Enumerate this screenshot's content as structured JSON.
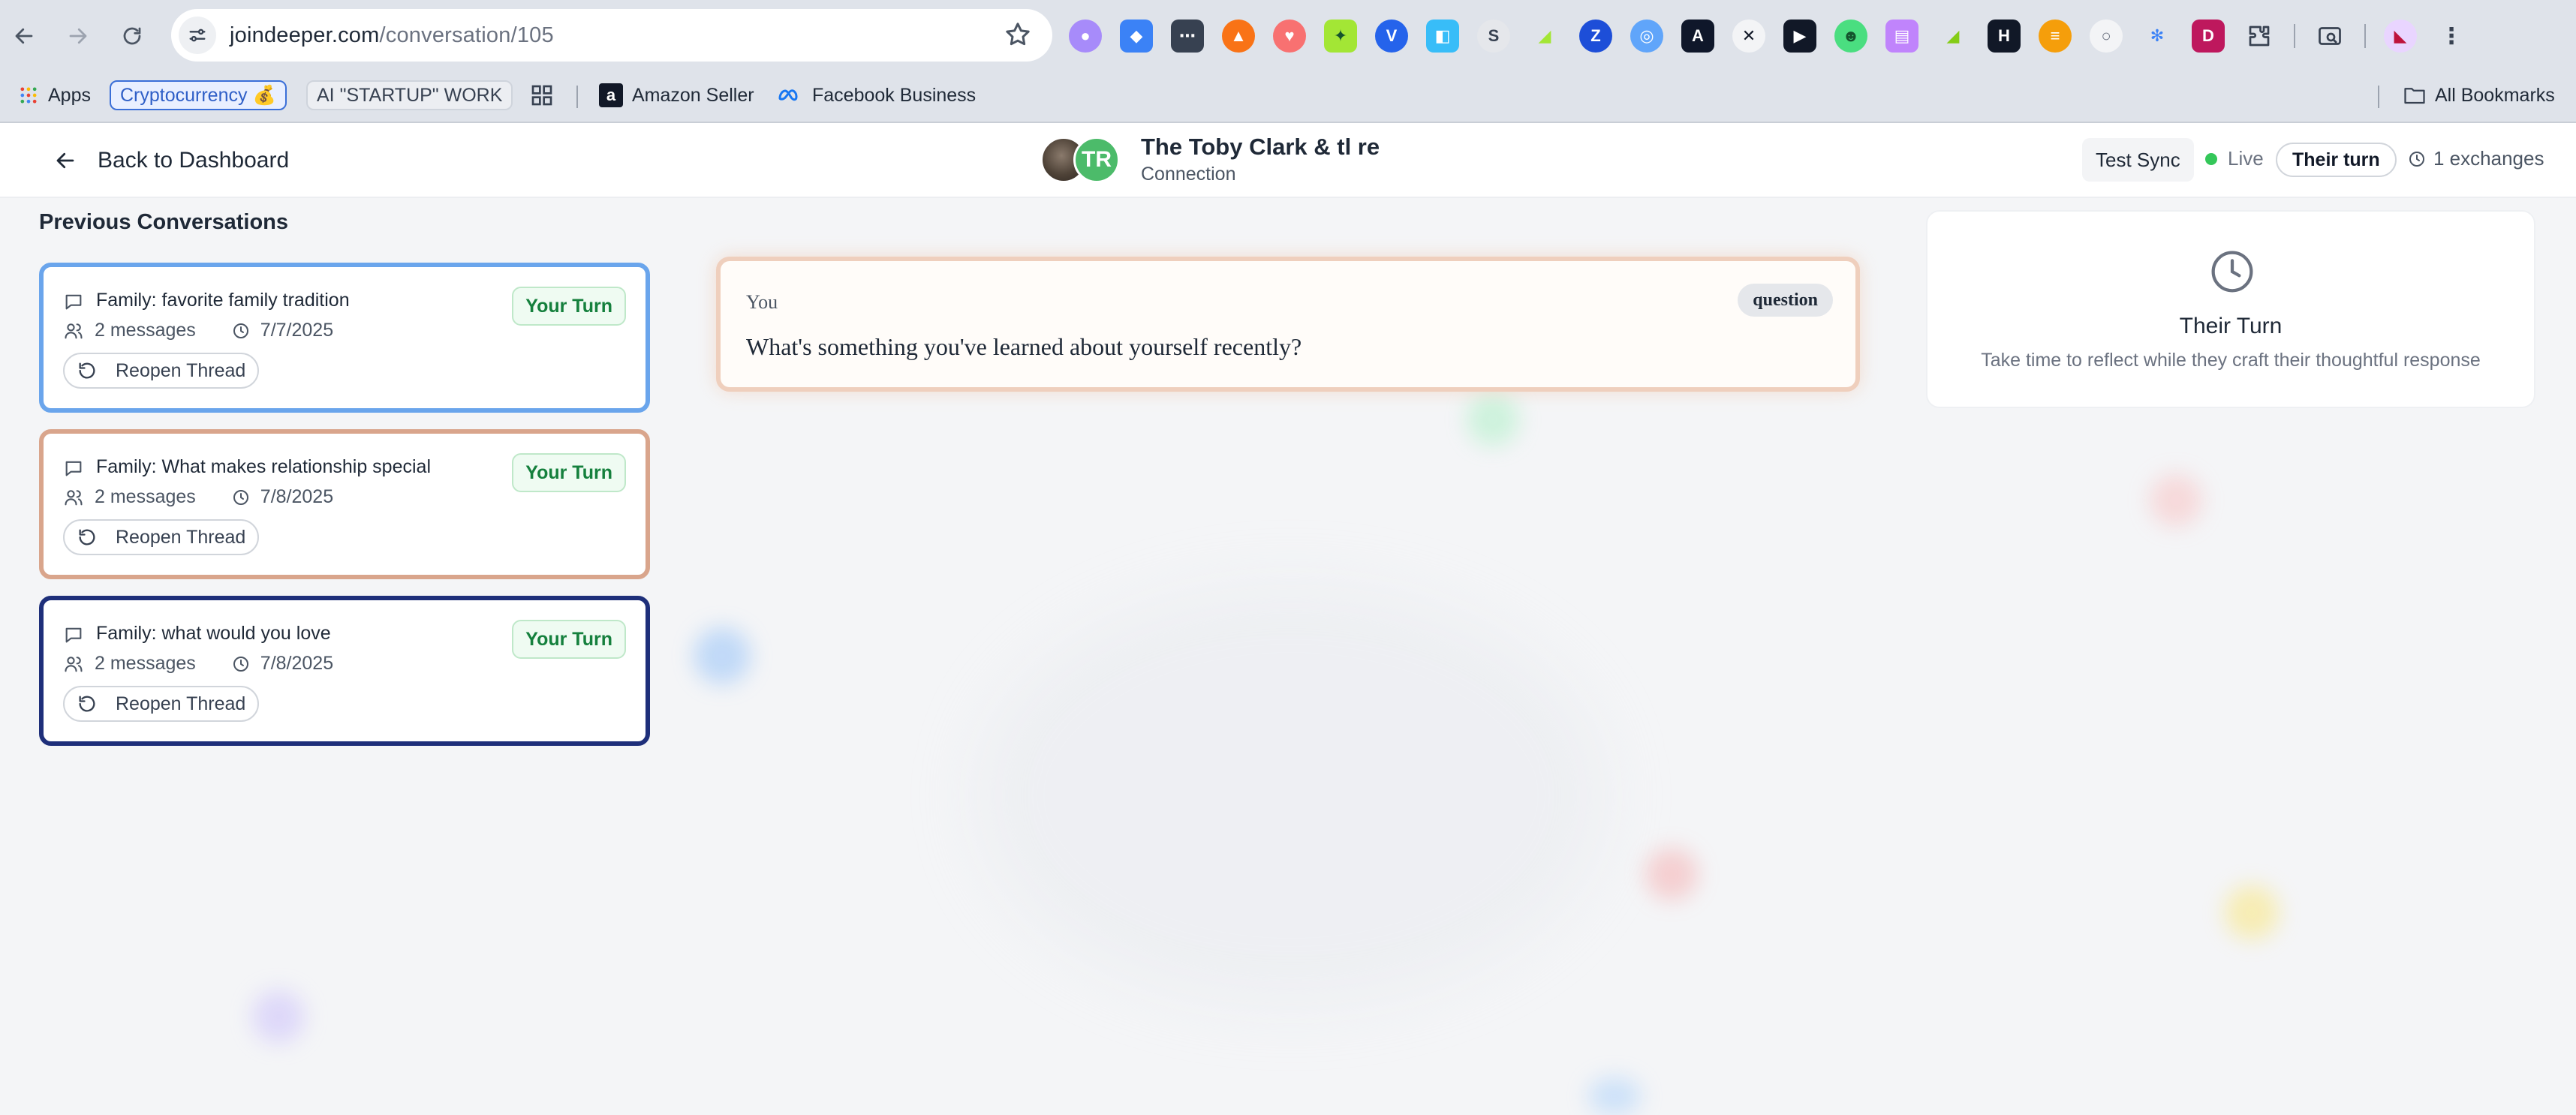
{
  "browser": {
    "url_host": "joindeeper.com",
    "url_path": "/conversation/105",
    "bookmarks": {
      "apps": "Apps",
      "crypto": "Cryptocurrency 💰",
      "ai_startup": "AI \"STARTUP\" WORK",
      "amazon": "Amazon Seller",
      "facebook": "Facebook Business",
      "all": "All Bookmarks"
    }
  },
  "header": {
    "back_label": "Back to Dashboard",
    "avatar_initials": "TR",
    "title": "The Toby Clark & tl re",
    "subtitle": "Connection",
    "test_sync": "Test Sync",
    "live": "Live",
    "turn_status": "Their turn",
    "exchanges": "1 exchanges"
  },
  "sidebar": {
    "title": "Previous Conversations",
    "cards": [
      {
        "topic": "Family: favorite family tradition",
        "messages": "2 messages",
        "date": "7/7/2025",
        "badge": "Your Turn",
        "reopen": "Reopen Thread",
        "border": "#6aa5ec"
      },
      {
        "topic": "Family: What makes relationship special",
        "messages": "2 messages",
        "date": "7/8/2025",
        "badge": "Your Turn",
        "reopen": "Reopen Thread",
        "border": "#d9a58c"
      },
      {
        "topic": "Family: what would you love",
        "messages": "2 messages",
        "date": "7/8/2025",
        "badge": "Your Turn",
        "reopen": "Reopen Thread",
        "border": "#1e2f7a"
      }
    ]
  },
  "question": {
    "sender": "You",
    "type": "question",
    "text": "What's something you've learned about yourself recently?"
  },
  "turn_panel": {
    "title": "Their Turn",
    "description": "Take time to reflect while they craft their thoughtful response"
  }
}
